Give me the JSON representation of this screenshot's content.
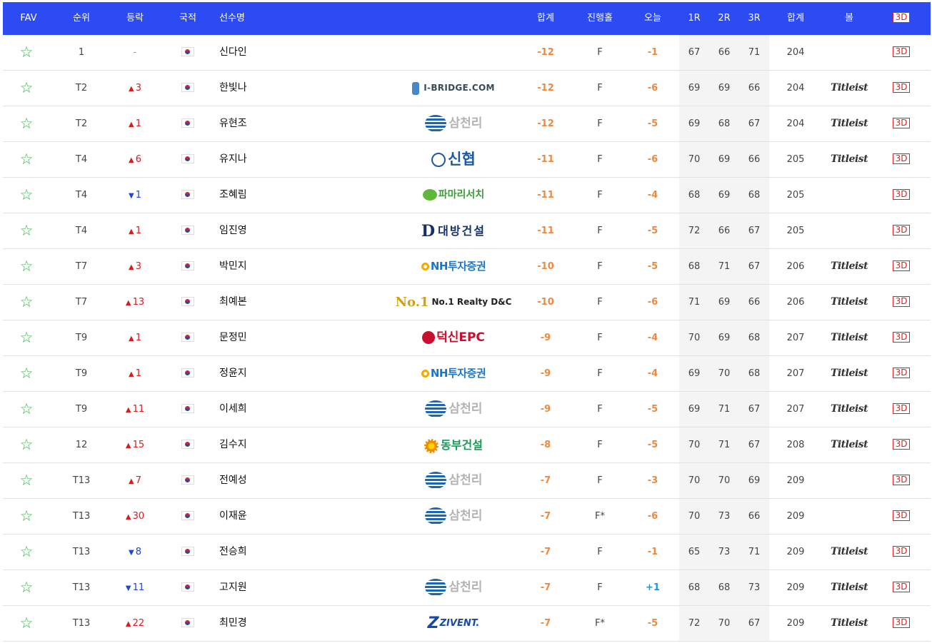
{
  "header": {
    "fav": "FAV",
    "rank": "순위",
    "move": "등락",
    "nation": "국적",
    "player": "선수명",
    "total": "합계",
    "progress": "진행홀",
    "today": "오늘",
    "r1": "1R",
    "r2": "2R",
    "r3": "3R",
    "sum": "합계",
    "ball": "볼",
    "view3d": "3D"
  },
  "colors": {
    "header_bg": "#2d4bf2",
    "up": "#e01818",
    "down": "#1c45e0",
    "score": "#f2873b",
    "star": "#37b349"
  },
  "icons": {
    "fav": "star-outline-icon",
    "nation": "korea-flag-icon",
    "ball_brand": "titleist-logo"
  },
  "rows": [
    {
      "rank": "1",
      "move": "-",
      "dir": "flat",
      "name": "신다인",
      "sponsor": "",
      "total": "-12",
      "prog": "F",
      "today": "-1",
      "r1": "67",
      "r2": "66",
      "r3": "71",
      "sum": "204",
      "ball": "",
      "v3d": "3D"
    },
    {
      "rank": "T2",
      "move": "3",
      "dir": "up",
      "name": "한빛나",
      "sponsor": "I-BRIDGE.COM",
      "total": "-12",
      "prog": "F",
      "today": "-6",
      "r1": "69",
      "r2": "69",
      "r3": "66",
      "sum": "204",
      "ball": "Titleist",
      "v3d": "3D"
    },
    {
      "rank": "T2",
      "move": "1",
      "dir": "up",
      "name": "유현조",
      "sponsor": "삼천리",
      "total": "-12",
      "prog": "F",
      "today": "-5",
      "r1": "69",
      "r2": "68",
      "r3": "67",
      "sum": "204",
      "ball": "Titleist",
      "v3d": "3D"
    },
    {
      "rank": "T4",
      "move": "6",
      "dir": "up",
      "name": "유지나",
      "sponsor": "신협",
      "total": "-11",
      "prog": "F",
      "today": "-6",
      "r1": "70",
      "r2": "69",
      "r3": "66",
      "sum": "205",
      "ball": "Titleist",
      "v3d": "3D"
    },
    {
      "rank": "T4",
      "move": "1",
      "dir": "down",
      "name": "조혜림",
      "sponsor": "파마리서치",
      "total": "-11",
      "prog": "F",
      "today": "-4",
      "r1": "68",
      "r2": "69",
      "r3": "68",
      "sum": "205",
      "ball": "",
      "v3d": "3D"
    },
    {
      "rank": "T4",
      "move": "1",
      "dir": "up",
      "name": "임진영",
      "sponsor": "대방건설",
      "total": "-11",
      "prog": "F",
      "today": "-5",
      "r1": "72",
      "r2": "66",
      "r3": "67",
      "sum": "205",
      "ball": "",
      "v3d": "3D"
    },
    {
      "rank": "T7",
      "move": "3",
      "dir": "up",
      "name": "박민지",
      "sponsor": "NH투자증권",
      "total": "-10",
      "prog": "F",
      "today": "-5",
      "r1": "68",
      "r2": "71",
      "r3": "67",
      "sum": "206",
      "ball": "Titleist",
      "v3d": "3D"
    },
    {
      "rank": "T7",
      "move": "13",
      "dir": "up",
      "name": "최예본",
      "sponsor": "No.1 Realty D&C",
      "total": "-10",
      "prog": "F",
      "today": "-6",
      "r1": "71",
      "r2": "69",
      "r3": "66",
      "sum": "206",
      "ball": "Titleist",
      "v3d": "3D"
    },
    {
      "rank": "T9",
      "move": "1",
      "dir": "up",
      "name": "문정민",
      "sponsor": "덕신EPC",
      "total": "-9",
      "prog": "F",
      "today": "-4",
      "r1": "70",
      "r2": "69",
      "r3": "68",
      "sum": "207",
      "ball": "Titleist",
      "v3d": "3D"
    },
    {
      "rank": "T9",
      "move": "1",
      "dir": "up",
      "name": "정윤지",
      "sponsor": "NH투자증권",
      "total": "-9",
      "prog": "F",
      "today": "-4",
      "r1": "69",
      "r2": "70",
      "r3": "68",
      "sum": "207",
      "ball": "Titleist",
      "v3d": "3D"
    },
    {
      "rank": "T9",
      "move": "11",
      "dir": "up",
      "name": "이세희",
      "sponsor": "삼천리",
      "total": "-9",
      "prog": "F",
      "today": "-5",
      "r1": "69",
      "r2": "71",
      "r3": "67",
      "sum": "207",
      "ball": "Titleist",
      "v3d": "3D"
    },
    {
      "rank": "12",
      "move": "15",
      "dir": "up",
      "name": "김수지",
      "sponsor": "동부건설",
      "total": "-8",
      "prog": "F",
      "today": "-5",
      "r1": "70",
      "r2": "71",
      "r3": "67",
      "sum": "208",
      "ball": "Titleist",
      "v3d": "3D"
    },
    {
      "rank": "T13",
      "move": "7",
      "dir": "up",
      "name": "전예성",
      "sponsor": "삼천리",
      "total": "-7",
      "prog": "F",
      "today": "-3",
      "r1": "70",
      "r2": "70",
      "r3": "69",
      "sum": "209",
      "ball": "",
      "v3d": "3D"
    },
    {
      "rank": "T13",
      "move": "30",
      "dir": "up",
      "name": "이재윤",
      "sponsor": "삼천리",
      "total": "-7",
      "prog": "F*",
      "today": "-6",
      "r1": "70",
      "r2": "73",
      "r3": "66",
      "sum": "209",
      "ball": "",
      "v3d": "3D"
    },
    {
      "rank": "T13",
      "move": "8",
      "dir": "down",
      "name": "전승희",
      "sponsor": "",
      "total": "-7",
      "prog": "F",
      "today": "-1",
      "r1": "65",
      "r2": "73",
      "r3": "71",
      "sum": "209",
      "ball": "Titleist",
      "v3d": "3D"
    },
    {
      "rank": "T13",
      "move": "11",
      "dir": "down",
      "name": "고지원",
      "sponsor": "삼천리",
      "total": "-7",
      "prog": "F",
      "today": "+1",
      "r1": "68",
      "r2": "68",
      "r3": "73",
      "sum": "209",
      "ball": "Titleist",
      "v3d": "3D"
    },
    {
      "rank": "T13",
      "move": "22",
      "dir": "up",
      "name": "최민경",
      "sponsor": "ZIVENT.",
      "total": "-7",
      "prog": "F*",
      "today": "-5",
      "r1": "72",
      "r2": "70",
      "r3": "67",
      "sum": "209",
      "ball": "Titleist",
      "v3d": "3D"
    }
  ]
}
